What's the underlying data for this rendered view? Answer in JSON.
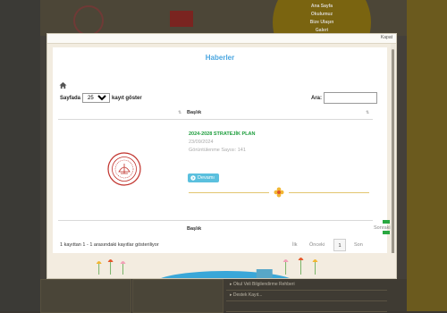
{
  "background": {
    "nav_items": [
      "Ana Sayfa",
      "Okulumuz",
      "Bize Ulaşın",
      "Galeri"
    ],
    "list_items": [
      "Okul Veli Bilgilendirme Rehberi",
      "Destek Kayıt...",
      ""
    ]
  },
  "modal": {
    "close_label": "Kapat",
    "title": "Haberler",
    "length_prefix": "Sayfada",
    "length_value": "25",
    "length_suffix": "kayıt göster",
    "search_label": "Ara:",
    "search_value": "",
    "column_header": "Başlık",
    "column_footer": "Başlık",
    "news": [
      {
        "title": "2024-2028 STRATEJİK PLAN",
        "date": "23/09/2024",
        "views": "Görüntülenme Sayısı: 141",
        "more_label": "Devamı"
      }
    ],
    "info": "1 kayıttan 1 - 1 arasındaki kayıtlar gösteriliyor",
    "pagination": {
      "first": "İlk",
      "prev": "Önceki",
      "current": "1",
      "next": "Son",
      "next_alt": "Sonraki"
    }
  },
  "colors": {
    "title": "#4aa6e0",
    "news_title": "#1a9c3a",
    "button": "#5bc0de",
    "side_button": "#2aa840"
  }
}
